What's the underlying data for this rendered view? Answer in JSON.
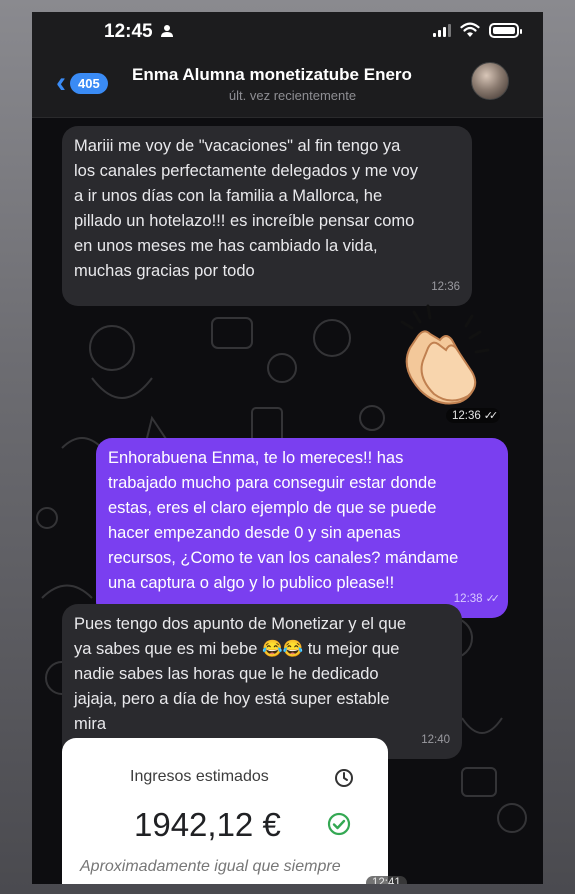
{
  "status_bar": {
    "time": "12:45",
    "battery_level": 1.0
  },
  "header": {
    "back_count": "405",
    "contact_name": "Enma Alumna monetizatube Enero",
    "last_seen": "últ. vez recientemente"
  },
  "messages": [
    {
      "direction": "incoming",
      "lines": [
        "Mariii me voy de \"vacaciones\" al fin tengo ya",
        "los canales perfectamente delegados y me voy",
        "a ir unos días con la familia a Mallorca, he",
        "pillado un hotelazo!!! es increíble pensar como",
        "en unos meses me has cambiado la vida,",
        "muchas gracias por todo"
      ],
      "time": "12:36"
    },
    {
      "direction": "outgoing",
      "type": "sticker",
      "icon": "clapping-hands-emoji",
      "time": "12:36"
    },
    {
      "direction": "outgoing",
      "lines": [
        "Enhorabuena Enma, te lo mereces!! has",
        "trabajado mucho para conseguir estar donde",
        "estas, eres el claro ejemplo de que se puede",
        "hacer empezando desde 0 y sin apenas",
        "recursos, ¿Como te van los canales? mándame",
        "una captura o algo y lo publico please!!"
      ],
      "time": "12:38"
    },
    {
      "direction": "incoming",
      "lines": [
        "Pues tengo dos apunto de Monetizar y el que",
        "ya sabes que es mi bebe 😂😂 tu mejor que",
        "nadie sabes las horas que le he dedicado",
        "jajaja, pero a día de hoy está super estable",
        "mira"
      ],
      "time": "12:40"
    },
    {
      "direction": "incoming",
      "type": "image",
      "card": {
        "title": "Ingresos estimados",
        "amount": "1942,12 €",
        "note": "Aproximadamente igual que siempre"
      },
      "time": "12:41"
    }
  ],
  "colors": {
    "outgoing_bubble": "#7a3ff0",
    "incoming_bubble": "#2a2a2e",
    "accent": "#3a8bf5",
    "check_green": "#34a853"
  }
}
